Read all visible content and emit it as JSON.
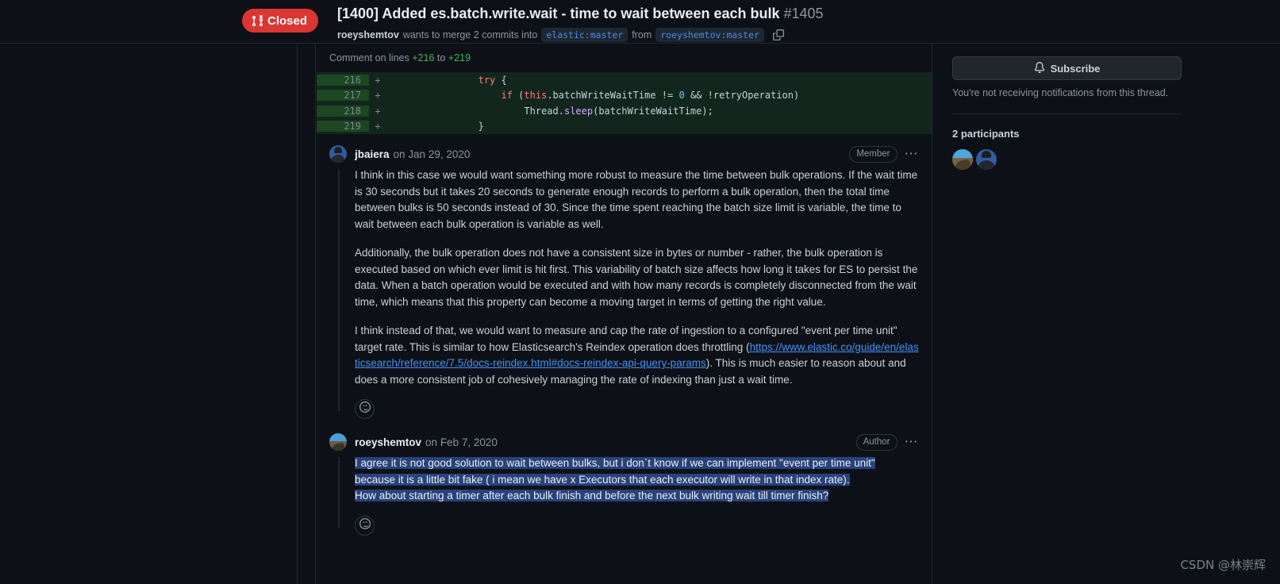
{
  "header": {
    "state_label": "Closed",
    "state_icon": "pull-request-closed-icon",
    "state_color": "#da3633",
    "title": "[1400] Added es.batch.write.wait - time to wait between each bulk",
    "number": "#1405",
    "author": "roeyshemtov",
    "merge_text": "wants to merge 2 commits into",
    "base_branch": "elastic:master",
    "from_text": "from",
    "head_branch": "roeyshemtov:master",
    "copy_icon": "copy-icon"
  },
  "diff": {
    "comment_on_prefix": "Comment on lines",
    "start_line": "+216",
    "to_text": "to",
    "end_line": "+219",
    "rows": [
      {
        "num": "216",
        "sign": "+",
        "code": "                try {"
      },
      {
        "num": "217",
        "sign": "+",
        "code": "                    if (this.batchWriteWaitTime != 0 && !retryOperation)"
      },
      {
        "num": "218",
        "sign": "+",
        "code": "                        Thread.sleep(batchWriteWaitTime);"
      },
      {
        "num": "219",
        "sign": "+",
        "code": "                }"
      }
    ]
  },
  "comments": [
    {
      "author": "jbaiera",
      "date": "on Jan 29, 2020",
      "role": "Member",
      "avatar": "avatar-jbaiera",
      "paragraphs": [
        "I think in this case we would want something more robust to measure the time between bulk operations. If the wait time is 30 seconds but it takes 20 seconds to generate enough records to perform a bulk operation, then the total time between bulks is 50 seconds instead of 30. Since the time spent reaching the batch size limit is variable, the time to wait between each bulk operation is variable as well.",
        "Additionally, the bulk operation does not have a consistent size in bytes or number - rather, the bulk operation is executed based on which ever limit is hit first. This variability of batch size affects how long it takes for ES to persist the data. When a batch operation would be executed and with how many records is completely disconnected from the wait time, which means that this property can become a moving target in terms of getting the right value."
      ],
      "link_paragraph": {
        "before": "I think instead of that, we would want to measure and cap the rate of ingestion to a configured \"event per time unit\" target rate. This is similar to how Elasticsearch's Reindex operation does throttling (",
        "link": "https://www.elastic.co/guide/en/elasticsearch/reference/7.5/docs-reindex.html#docs-reindex-api-query-params",
        "after": "). This is much easier to reason about and does a more consistent job of cohesively managing the rate of indexing than just a wait time."
      },
      "reaction_icon": "emoji-smiley-icon"
    },
    {
      "author": "roeyshemtov",
      "date": "on Feb 7, 2020",
      "role": "Author",
      "avatar": "avatar-roeyshemtov",
      "selected_text_line1": "I agree it is not good solution to wait between bulks, but i don`t know if we can implement \"event per time unit\"",
      "selected_text_line2": "because it is a little bit fake ( i mean we have x Executors that each executor will write in that index rate).",
      "selected_text_line3": "How about starting a timer after each bulk finish and before the next bulk writing wait till timer finish?",
      "reaction_icon": "emoji-smiley-icon"
    }
  ],
  "sidebar": {
    "subscribe_label": "Subscribe",
    "subscribe_icon": "bell-icon",
    "notification_note": "You're not receiving notifications from this thread.",
    "participants_title": "2 participants",
    "participant_avatars": [
      "avatar-roeyshemtov",
      "avatar-jbaiera"
    ]
  },
  "watermark": "CSDN @林崇辉"
}
